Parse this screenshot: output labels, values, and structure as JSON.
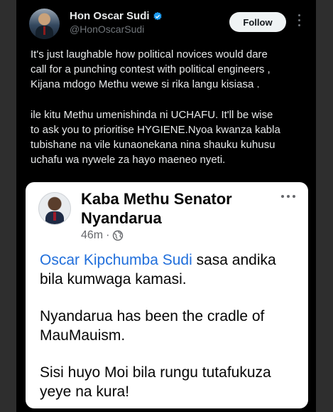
{
  "tweet": {
    "author_name": "Hon Oscar Sudi",
    "handle": "@HonOscarSudi",
    "follow_label": "Follow",
    "lines": [
      "It's just laughable how political novices would dare",
      "call for a punching contest with political engineers ,",
      "Kijana mdogo Methu  wewe si rika langu kisiasa .",
      "ile kitu Methu umenishinda ni UCHAFU. It'll be wise",
      "to ask you to prioritise HYGIENE.Nyoa kwanza kabla",
      "tubishane na vile kunaonekana nina shauku kuhusu",
      "uchafu wa nywele za hayo maeneo nyeti."
    ]
  },
  "embedded_post": {
    "author_line1": "Kaba Methu Senator",
    "author_line2": "Nyandarua",
    "time": "46m",
    "separator": "·",
    "mention": "Oscar Kipchumba Sudi",
    "line1_rest": " sasa andika",
    "line2": "bila kumwaga kamasi.",
    "line3": "Nyandarua has been the cradle of",
    "line4": "MauMauism.",
    "line5": "Sisi huyo Moi bila rungu tutafukuza",
    "line6": "yeye na kura!"
  },
  "colors": {
    "verified": "#1d9bf0",
    "mention": "#216fdb"
  }
}
